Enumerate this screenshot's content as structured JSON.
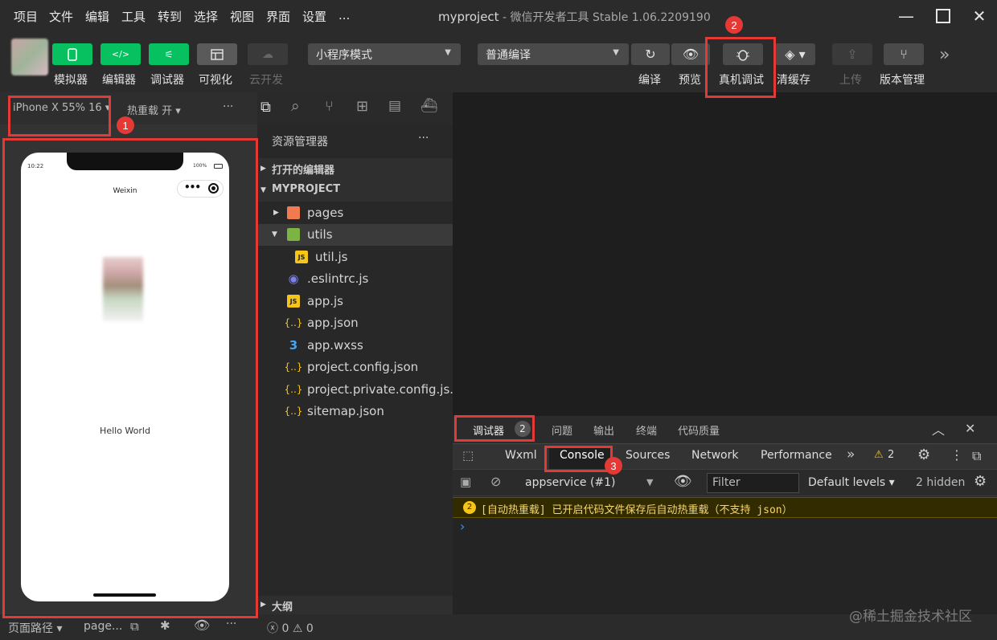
{
  "menu": [
    "项目",
    "文件",
    "编辑",
    "工具",
    "转到",
    "选择",
    "视图",
    "界面",
    "设置",
    "..."
  ],
  "window_title": {
    "project": "myproject",
    "app": " - 微信开发者工具 Stable 1.06.2209190"
  },
  "toolbar": {
    "simulator": "模拟器",
    "editor": "编辑器",
    "debugger": "调试器",
    "visual": "可视化",
    "cloud": "云开发",
    "mode_select": "小程序模式",
    "compile_select": "普通编译",
    "compile": "编译",
    "preview": "预览",
    "real_debug": "真机调试",
    "clear_cache": "清缓存",
    "upload": "上传",
    "version": "版本管理"
  },
  "simulator": {
    "device": "iPhone X 55% 16",
    "hot_reload": "热重载 开",
    "more": "···",
    "time": "10:22",
    "battery": "100%",
    "nav_title": "Weixin",
    "body_text": "Hello World"
  },
  "explorer": {
    "title": "资源管理器",
    "more": "···",
    "open_editors": "打开的编辑器",
    "project": "MYPROJECT",
    "outline": "大纲",
    "files": [
      {
        "name": "pages",
        "icon": "folder-icon"
      },
      {
        "name": "utils",
        "icon": "folder-icon"
      },
      {
        "name": "util.js",
        "icon": "js-icon"
      },
      {
        "name": ".eslintrc.js",
        "icon": "eslint-icon"
      },
      {
        "name": "app.js",
        "icon": "js-icon"
      },
      {
        "name": "app.json",
        "icon": "json-icon"
      },
      {
        "name": "app.wxss",
        "icon": "css-icon"
      },
      {
        "name": "project.config.json",
        "icon": "json-icon"
      },
      {
        "name": "project.private.config.js...",
        "icon": "json-icon"
      },
      {
        "name": "sitemap.json",
        "icon": "json-icon"
      }
    ]
  },
  "debug_tabs": {
    "debugger": "调试器",
    "debugger_count": "2",
    "problems": "问题",
    "output": "输出",
    "terminal": "终端",
    "quality": "代码质量"
  },
  "devtools_tabs": [
    "Wxml",
    "Console",
    "Sources",
    "Network",
    "Performance"
  ],
  "devtools": {
    "more": "»",
    "warn_count": "2",
    "context": "appservice (#1)",
    "filter_placeholder": "Filter",
    "levels": "Default levels",
    "hidden": "2 hidden"
  },
  "console": {
    "warn_count": "2",
    "message": "[自动热重载] 已开启代码文件保存后自动热重载（不支持 json）",
    "prompt": "›"
  },
  "status": {
    "page_path": "页面路径",
    "page": "page...",
    "errors": "0",
    "warnings": "0"
  },
  "annotations": {
    "one": "1",
    "two": "2",
    "three": "3"
  },
  "watermark": "@稀土掘金技术社区",
  "colors": {
    "green": "#07c160",
    "red": "#e53935",
    "folder": "#f27a4f"
  }
}
